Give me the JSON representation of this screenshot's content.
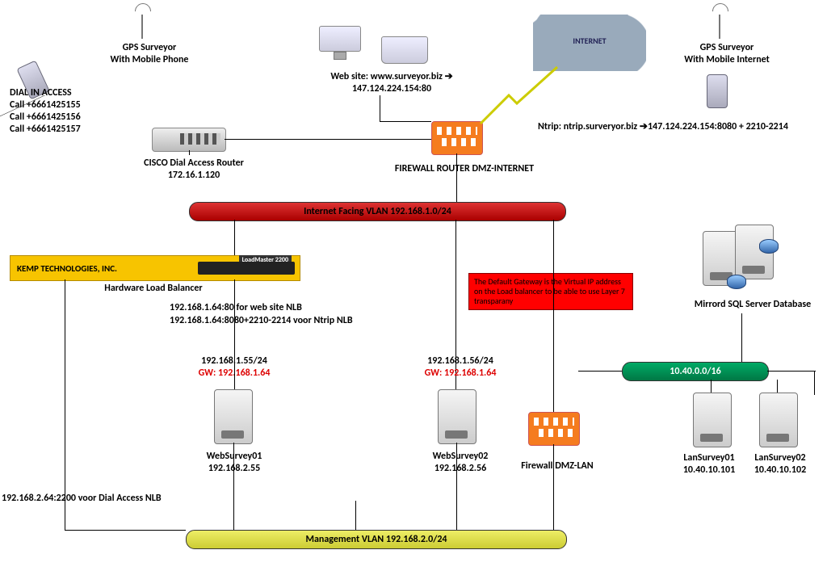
{
  "top": {
    "gps_mobile_phone": "GPS Surveyor\nWith Mobile Phone",
    "dial_in_title": "DIAL IN ACCESS",
    "dial_lines": [
      "Call +6661425155",
      "Call +6661425156",
      "Call +6661425157"
    ],
    "website": "Web site: www.surveyor.biz ➔\n147.124.224.154:80",
    "internet_cloud": "INTERNET",
    "gps_mobile_internet": "GPS Surveyor\nWith Mobile Internet",
    "ntrip": "Ntrip: ntrip.surveryor.biz ➔147.124.224.154:8080 + 2210-2214",
    "cisco_router": "CISCO Dial Access Router\n172.16.1.120",
    "firewall_dmz_internet": "FIREWALL ROUTER DMZ-INTERNET"
  },
  "vlans": {
    "internet_facing": "Internet Facing VLAN 192.168.1.0/24",
    "db_segment": "10.40.0.0/16",
    "management": "Management VLAN 192.168.2.0/24"
  },
  "lb": {
    "brand": "KEMP  TECHNOLOGIES, INC.",
    "model": "LoadMaster 2200",
    "caption": "Hardware Load Balancer",
    "nlb_web": "192.168.1.64:80 for web site NLB",
    "nlb_ntrip": "192.168.1.64:8080+2210-2214 voor Ntrip NLB"
  },
  "note_gateway": "The Default Gateway is the Virtual IP address on the Load balancer to be able to use Layer 7 transparany",
  "hosts": {
    "web1_ip": "192.168.1.55/24",
    "web1_gw": "GW: 192.168.1.64",
    "web1_name": "WebSurvey01\n192.168.2.55",
    "web2_ip": "192.168.1.56/24",
    "web2_gw": "GW: 192.168.1.64",
    "web2_name": "WebSurvey02\n192.168.2.56",
    "fw_lan": "Firewall DMZ-LAN",
    "lan1": "LanSurvey01\n10.40.10.101",
    "lan2": "LanSurvey02\n10.40.10.102",
    "db": "Mirrord SQL Server Database"
  },
  "bottom": {
    "dial_nlb": "192.168.2.64:2200 voor Dial Access NLB"
  }
}
